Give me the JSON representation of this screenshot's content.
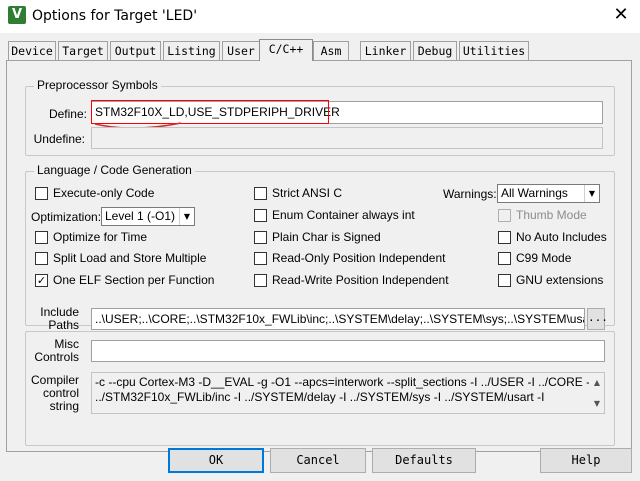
{
  "window": {
    "title": "Options for Target 'LED'",
    "icon_label": "V",
    "close_glyph": "✕"
  },
  "tabs": [
    "Device",
    "Target",
    "Output",
    "Listing",
    "User",
    "C/C++",
    "Asm",
    "Linker",
    "Debug",
    "Utilities"
  ],
  "active_tab": "C/C++",
  "preprocessor": {
    "group_title": "Preprocessor Symbols",
    "define_label": "Define:",
    "define_value": "STM32F10X_LD,USE_STDPERIPH_DRIVER",
    "undefine_label": "Undefine:",
    "undefine_value": ""
  },
  "language": {
    "group_title": "Language / Code Generation",
    "checkboxes_left": [
      {
        "label": "Execute-only Code",
        "checked": false
      },
      {
        "label": "Optimize for Time",
        "checked": false
      },
      {
        "label": "Split Load and Store Multiple",
        "checked": false
      },
      {
        "label": "One ELF Section per Function",
        "checked": true
      }
    ],
    "optimization_label": "Optimization:",
    "optimization_value": "Level 1 (-O1)",
    "checkboxes_middle": [
      {
        "label": "Strict ANSI C",
        "checked": false
      },
      {
        "label": "Enum Container always int",
        "checked": false
      },
      {
        "label": "Plain Char is Signed",
        "checked": false
      },
      {
        "label": "Read-Only Position Independent",
        "checked": false
      },
      {
        "label": "Read-Write Position Independent",
        "checked": false
      }
    ],
    "warnings_label": "Warnings:",
    "warnings_value": "All Warnings",
    "checkboxes_right": [
      {
        "label": "Thumb Mode",
        "checked": false,
        "disabled": true
      },
      {
        "label": "No Auto Includes",
        "checked": false
      },
      {
        "label": "C99 Mode",
        "checked": false
      },
      {
        "label": "GNU extensions",
        "checked": false
      }
    ]
  },
  "include_paths": {
    "label_line1": "Include",
    "label_line2": "Paths",
    "value": "..\\USER;..\\CORE;..\\STM32F10x_FWLib\\inc;..\\SYSTEM\\delay;..\\SYSTEM\\sys;..\\SYSTEM\\usart;..\\",
    "browse_label": "..."
  },
  "misc_controls": {
    "label_line1": "Misc",
    "label_line2": "Controls",
    "value": ""
  },
  "compiler_string": {
    "label_line1": "Compiler",
    "label_line2": "control",
    "label_line3": "string",
    "line1": "-c --cpu Cortex-M3 -D__EVAL -g -O1 --apcs=interwork --split_sections -I ../USER -I ../CORE -I",
    "line2": "../STM32F10x_FWLib/inc -I ../SYSTEM/delay -I ../SYSTEM/sys -I ../SYSTEM/usart -I"
  },
  "buttons": {
    "ok": "OK",
    "cancel": "Cancel",
    "defaults": "Defaults",
    "help": "Help"
  },
  "colors": {
    "annotation_red": "#d32f2f",
    "define_highlight": "#ff0000",
    "accent": "#0078d7"
  }
}
